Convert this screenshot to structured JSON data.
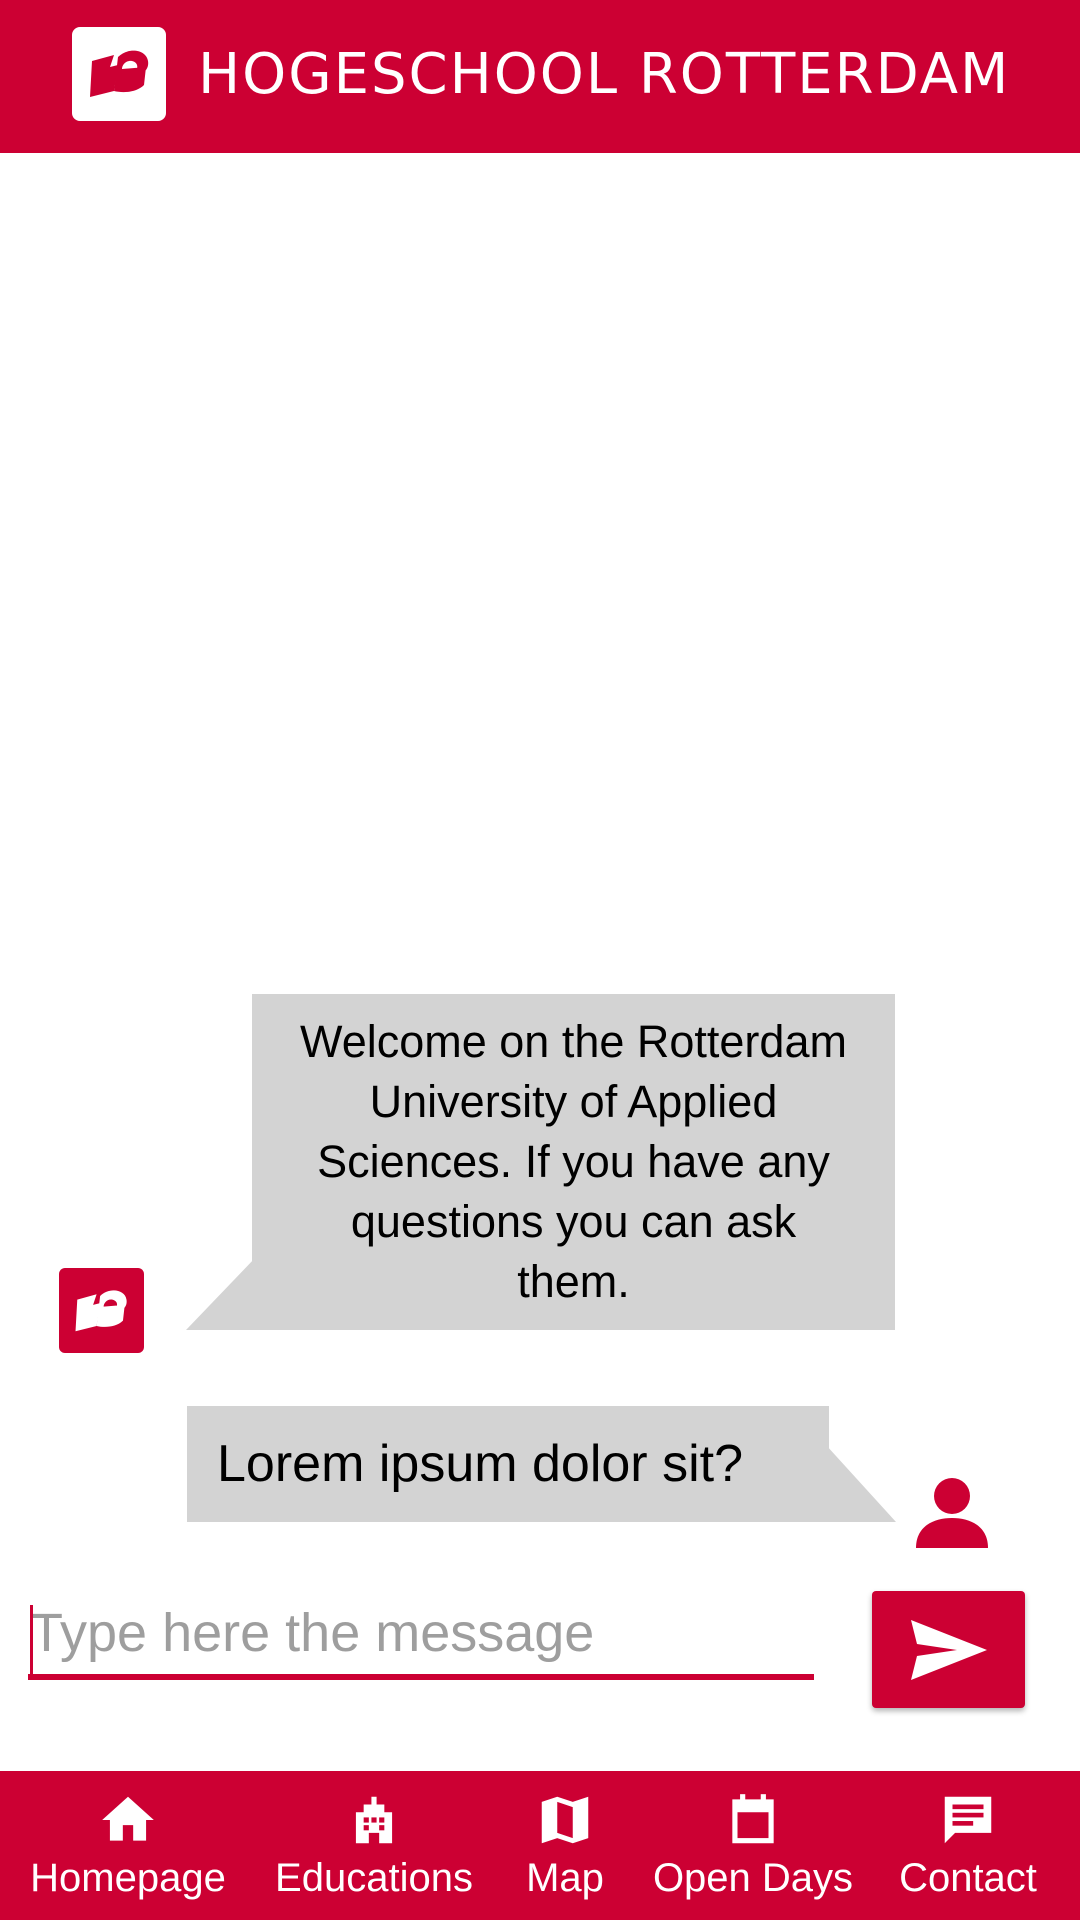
{
  "header": {
    "logo_icon": "hr-logo-icon",
    "title": "HOGESCHOOL  ROTTERDAM",
    "brand_color": "#cc0033"
  },
  "chat": {
    "messages": [
      {
        "sender": "bot",
        "avatar_icon": "hr-logo-icon",
        "text": "Welcome on the Rotterdam University of Applied Sciences. If you have any questions you can ask them."
      },
      {
        "sender": "user",
        "avatar_icon": "person-icon",
        "text": "Lorem ipsum dolor sit?"
      }
    ],
    "bubble_color": "#d3d3d3"
  },
  "composer": {
    "placeholder": "Type here the message",
    "value": "",
    "send_icon": "send-icon"
  },
  "nav": {
    "items": [
      {
        "label": "Homepage",
        "icon": "home-icon"
      },
      {
        "label": "Educations",
        "icon": "building-icon"
      },
      {
        "label": "Map",
        "icon": "map-icon"
      },
      {
        "label": "Open Days",
        "icon": "calendar-icon"
      },
      {
        "label": "Contact",
        "icon": "chat-icon"
      }
    ]
  }
}
